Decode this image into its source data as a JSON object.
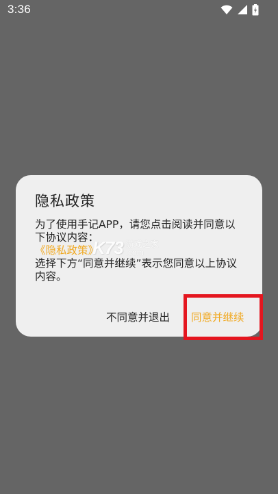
{
  "status_bar": {
    "time": "3:36",
    "icons": [
      "wifi-icon",
      "cellular-signal-icon",
      "battery-charging-icon"
    ]
  },
  "dialog": {
    "title": "隐私政策",
    "body_line_1": "为了使用手记APP，请您点击阅读并同意以",
    "body_line_2": "下协议内容：",
    "policy_link": "《隐私政策》",
    "body_line_3": "选择下方“同意并继续”表示您同意以上协议",
    "body_line_4": "内容。",
    "disagree_button": "不同意并退出",
    "agree_button": "同意并继续"
  },
  "watermark": {
    "logo": "K73",
    "text": "游戏之家",
    "domain": ".com"
  },
  "colors": {
    "backdrop": "#656565",
    "dialog_bg": "#efefef",
    "accent": "#f0a922",
    "highlight": "#e4161f"
  }
}
